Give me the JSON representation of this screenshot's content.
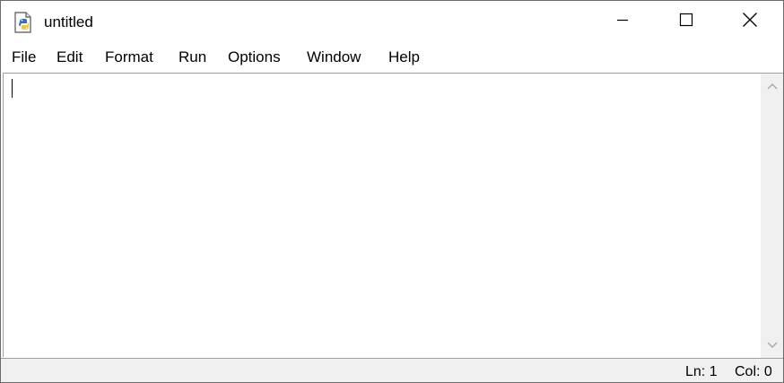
{
  "window": {
    "title": "untitled",
    "icon": "python-idle-file-icon",
    "controls": {
      "minimize_icon": "minimize-icon",
      "maximize_icon": "maximize-icon",
      "close_icon": "close-icon"
    }
  },
  "menubar": {
    "items": [
      {
        "label": "File"
      },
      {
        "label": "Edit"
      },
      {
        "label": "Format"
      },
      {
        "label": "Run"
      },
      {
        "label": "Options"
      },
      {
        "label": "Window"
      },
      {
        "label": "Help"
      }
    ]
  },
  "editor": {
    "content": ""
  },
  "statusbar": {
    "line": "Ln: 1",
    "column": "Col: 0"
  },
  "colors": {
    "background": "#ffffff",
    "chrome": "#f0f0f0",
    "border": "#a0a0a0",
    "text": "#000000"
  }
}
